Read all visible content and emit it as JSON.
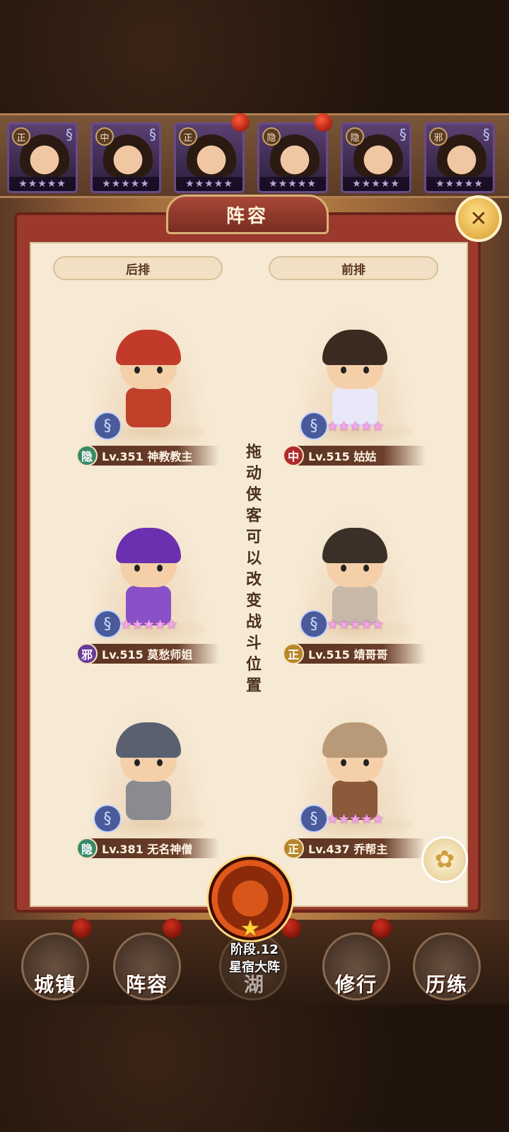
{
  "hero_strip": [
    {
      "badge": "正",
      "stars": "★★★★★"
    },
    {
      "badge": "中",
      "stars": "★★★★★"
    },
    {
      "badge": "正",
      "stars": "★★★★★"
    },
    {
      "badge": "隐",
      "stars": "★★★★★"
    },
    {
      "badge": "隐",
      "stars": "★★★★★"
    },
    {
      "badge": "邪",
      "stars": "★★★★★"
    }
  ],
  "panel": {
    "title": "阵容",
    "close_icon": "✕",
    "back_row_label": "后排",
    "front_row_label": "前排",
    "hint_chars": [
      "拖",
      "动",
      "侠",
      "客",
      "可",
      "以",
      "改",
      "变",
      "战",
      "斗",
      "位",
      "置"
    ]
  },
  "colors": {
    "隐": "#3a8a6a",
    "中": "#b02a2a",
    "邪": "#6a3a9a",
    "正": "#b8862a"
  },
  "slots": [
    {
      "faction": "隐",
      "text": "Lv.351 神教教主",
      "stars": "",
      "hair": "#c23a2a",
      "body": "#c0402a"
    },
    {
      "faction": "中",
      "text": "Lv.515 姑姑",
      "stars": "★★★★★",
      "hair": "#3a2a20",
      "body": "#e8e8f8"
    },
    {
      "faction": "邪",
      "text": "Lv.515 莫愁师姐",
      "stars": "★★★★★",
      "hair": "#6a30b0",
      "body": "#8a50c8"
    },
    {
      "faction": "正",
      "text": "Lv.515 靖哥哥",
      "stars": "★★★★★",
      "hair": "#3a3028",
      "body": "#c8b8a8"
    },
    {
      "faction": "隐",
      "text": "Lv.381 无名神僧",
      "stars": "",
      "hair": "#5a6070",
      "body": "#8a8a90"
    },
    {
      "faction": "正",
      "text": "Lv.437 乔帮主",
      "stars": "★★★★★",
      "hair": "#b89a78",
      "body": "#8a5a3a"
    }
  ],
  "formation": {
    "level": "阶段.12",
    "name": "星宿大阵",
    "star": "★"
  },
  "flower_icon": "✿",
  "nav": [
    "城镇",
    "阵容",
    "湖",
    "修行",
    "历练"
  ]
}
